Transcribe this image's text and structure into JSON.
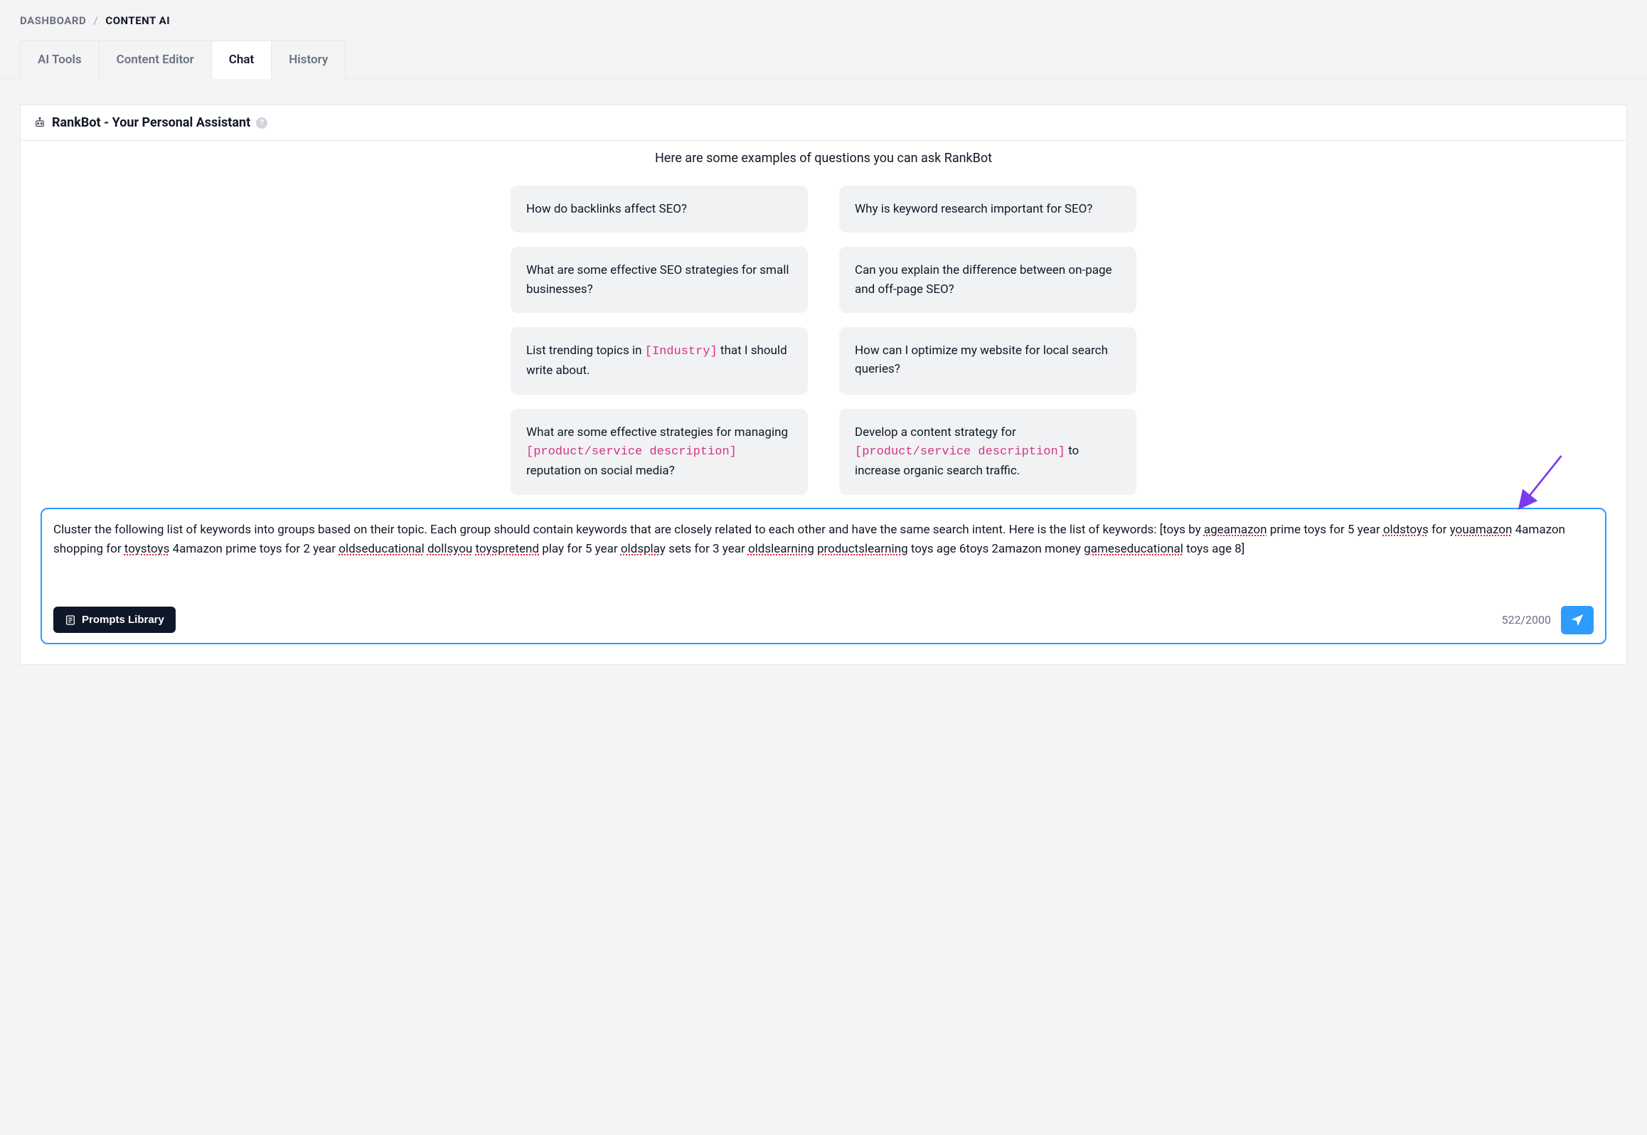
{
  "breadcrumb": {
    "root": "DASHBOARD",
    "current": "CONTENT AI"
  },
  "tabs": [
    {
      "label": "AI Tools",
      "active": false
    },
    {
      "label": "Content Editor",
      "active": false
    },
    {
      "label": "Chat",
      "active": true
    },
    {
      "label": "History",
      "active": false
    }
  ],
  "panel": {
    "title": "RankBot - Your Personal Assistant",
    "intro": "Here are some examples of questions you can ask RankBot"
  },
  "examples": [
    {
      "segments": [
        {
          "text": "How do backlinks affect SEO?"
        }
      ]
    },
    {
      "segments": [
        {
          "text": "Why is keyword research important for SEO?"
        }
      ]
    },
    {
      "segments": [
        {
          "text": "What are some effective SEO strategies for small businesses?"
        }
      ]
    },
    {
      "segments": [
        {
          "text": "Can you explain the difference between on-page and off-page SEO?"
        }
      ]
    },
    {
      "segments": [
        {
          "text": "List trending topics in "
        },
        {
          "text": "[Industry]",
          "placeholder": true
        },
        {
          "text": " that I should write about."
        }
      ]
    },
    {
      "segments": [
        {
          "text": "How can I optimize my website for local search queries?"
        }
      ]
    },
    {
      "segments": [
        {
          "text": "What are some effective strategies for managing "
        },
        {
          "text": "[product/service description]",
          "placeholder": true
        },
        {
          "text": " reputation on social media?"
        }
      ]
    },
    {
      "segments": [
        {
          "text": "Develop a content strategy for "
        },
        {
          "text": "[product/service description]",
          "placeholder": true
        },
        {
          "text": " to increase organic search traffic."
        }
      ]
    }
  ],
  "chat_input": {
    "segments": [
      {
        "text": "Cluster the following list of keywords into groups based on their topic. Each group should contain keywords that are closely related to each other and have the same search intent. Here is the list of keywords: [toys by "
      },
      {
        "text": "ageamazon",
        "err": true
      },
      {
        "text": " prime toys for 5 year "
      },
      {
        "text": "oldstoys",
        "err": true
      },
      {
        "text": " for "
      },
      {
        "text": "youamazon",
        "err": true
      },
      {
        "text": " 4amazon shopping for "
      },
      {
        "text": "toystoys",
        "err": true
      },
      {
        "text": " 4amazon prime toys for 2 year "
      },
      {
        "text": "oldseducational",
        "err": true
      },
      {
        "text": " "
      },
      {
        "text": "dollsyou",
        "err": true
      },
      {
        "text": " "
      },
      {
        "text": "toyspretend",
        "err": true
      },
      {
        "text": " play for 5 year "
      },
      {
        "text": "oldsplay",
        "err": true
      },
      {
        "text": " sets for 3 year "
      },
      {
        "text": "oldslearning",
        "err": true
      },
      {
        "text": " "
      },
      {
        "text": "productslearning",
        "err": true
      },
      {
        "text": " toys age 6toys 2amazon money "
      },
      {
        "text": "gameseducational",
        "err": true
      },
      {
        "text": " toys age 8]"
      }
    ],
    "char_count": "522/2000",
    "prompts_library_label": "Prompts Library"
  }
}
